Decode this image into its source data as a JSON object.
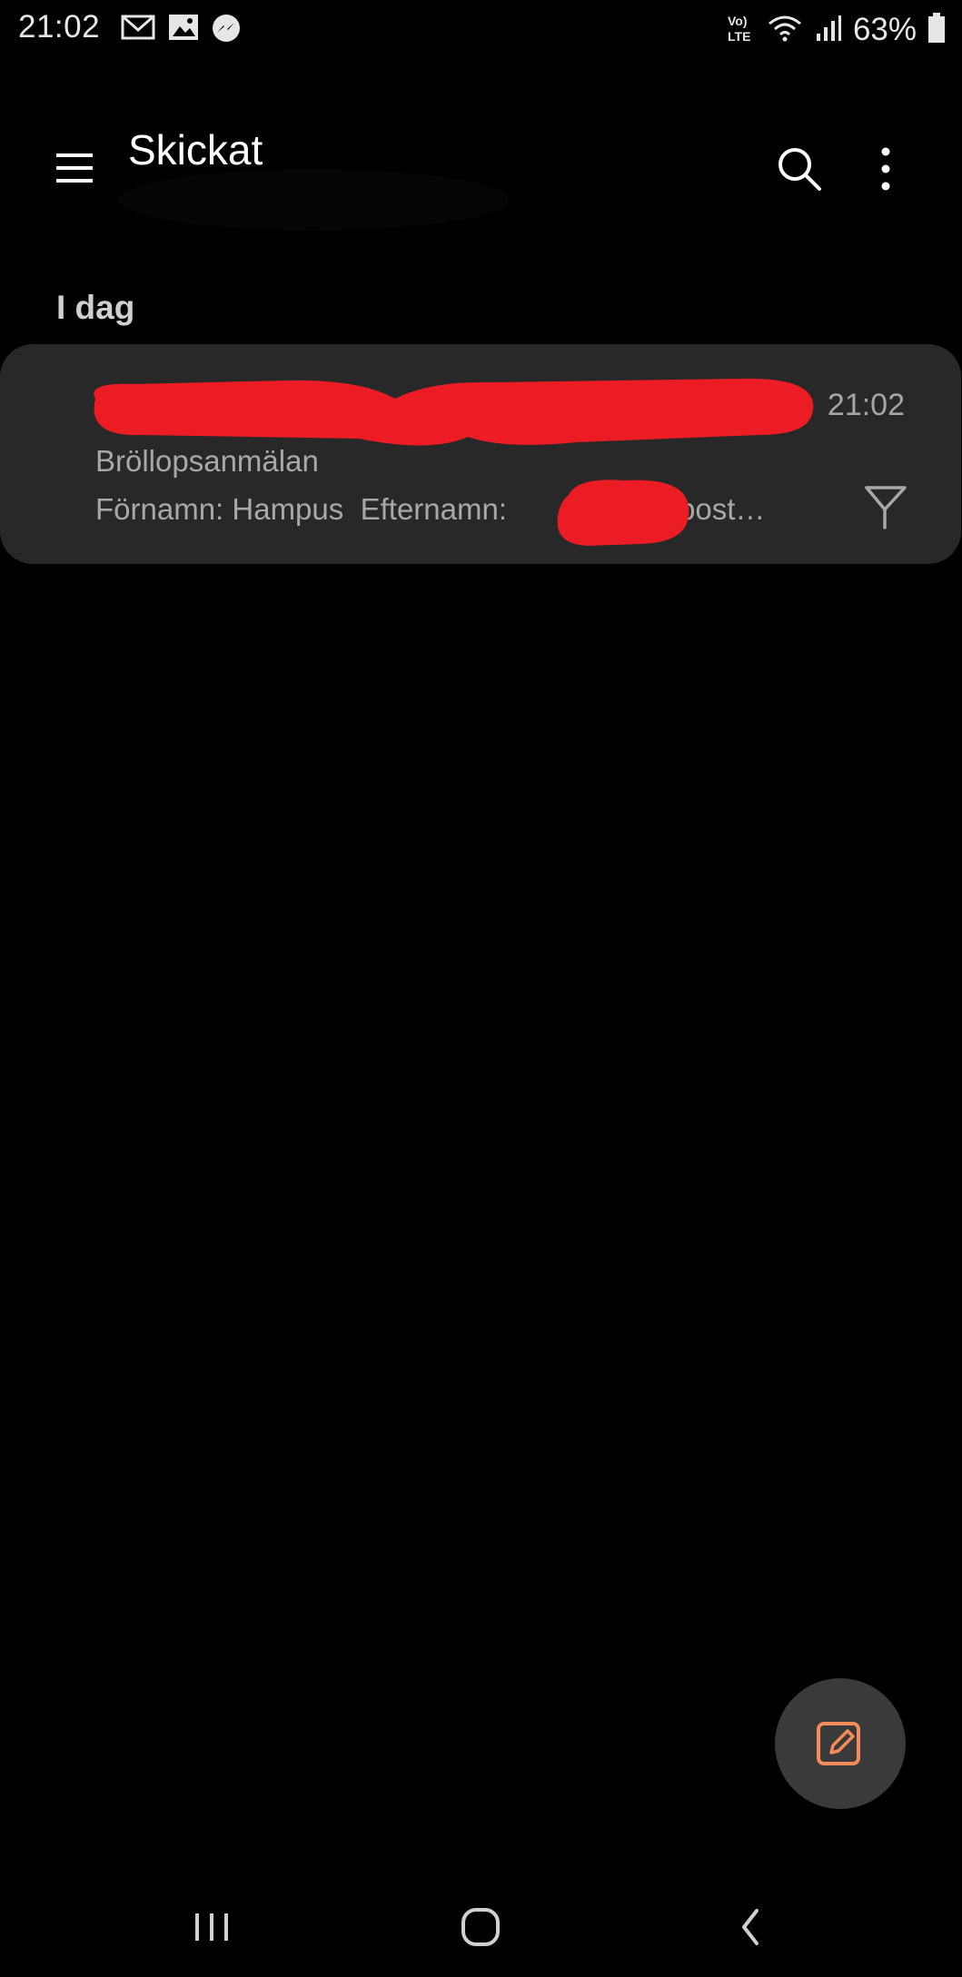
{
  "status_bar": {
    "time": "21:02",
    "notification_icons": [
      "gmail-icon",
      "gallery-icon",
      "messenger-icon"
    ],
    "network_label": "VoLTE",
    "battery": "63%"
  },
  "app_bar": {
    "title": "Skickat",
    "icons": [
      "menu-icon",
      "search-icon",
      "more-options-icon"
    ]
  },
  "section": {
    "label": "I dag"
  },
  "mail_list": [
    {
      "time": "21:02",
      "subject": "Bröllopsanmälan",
      "preview_first_name": "Förnamn: Hampus",
      "preview_last_name_label": "Efternamn:",
      "preview_email": "E-post…",
      "flag_icon": "flag-icon"
    }
  ],
  "fab": {
    "icon": "compose-icon"
  },
  "nav_bar": {
    "icons": [
      "recent-apps-icon",
      "home-icon",
      "back-icon"
    ]
  },
  "colors": {
    "background": "#000000",
    "card": "#282828",
    "redaction": "#ec1c24",
    "accent_compose": "#f48c5a",
    "secondary_text": "#a8a8a8"
  }
}
